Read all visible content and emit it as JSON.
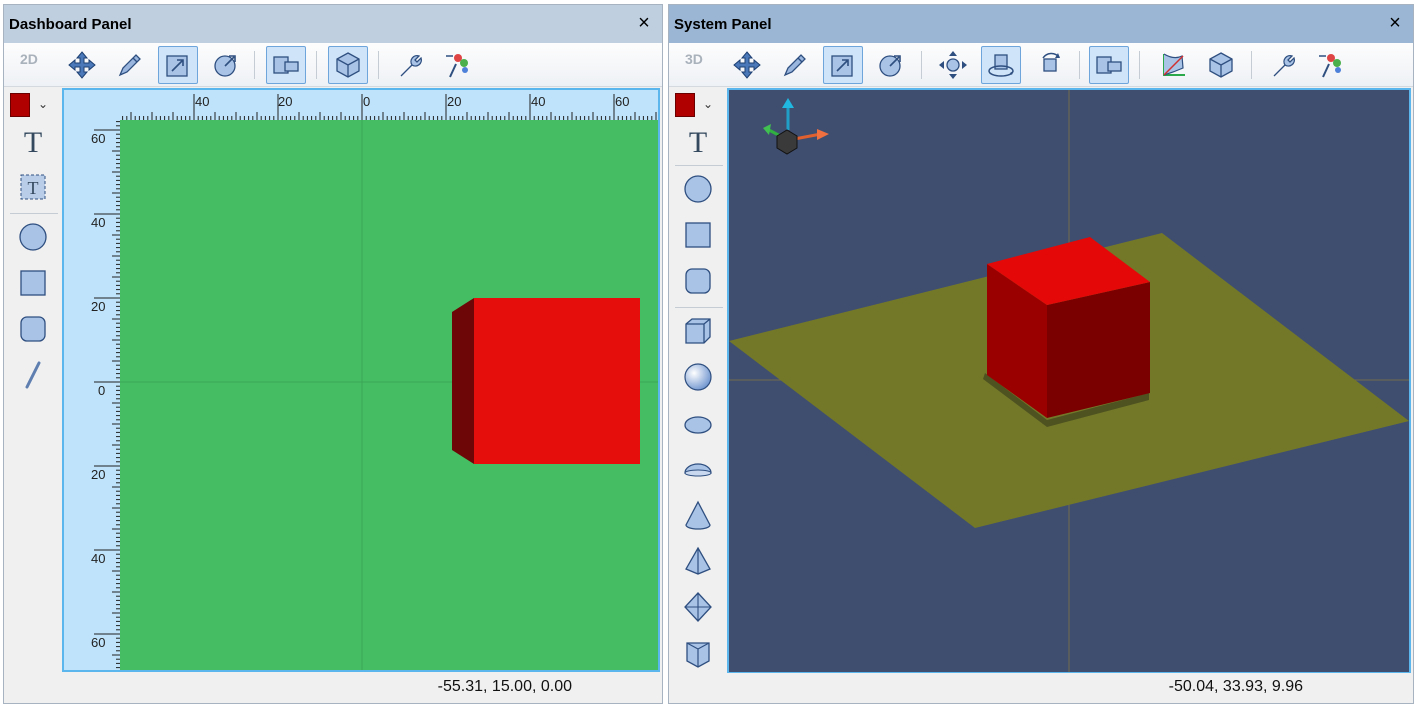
{
  "left_panel": {
    "title": "Dashboard Panel",
    "close_label": "×",
    "mode_label": "2D",
    "coordinates": "-55.31, 15.00, 0.00",
    "ruler_top_labels": [
      "40",
      "20",
      "0",
      "20",
      "40",
      "60"
    ],
    "ruler_left_labels": [
      "60",
      "40",
      "20",
      "0",
      "20",
      "40",
      "60"
    ],
    "colors": {
      "canvas": "#45bd63",
      "ruler": "#bfe3fa",
      "cube_face": "#e60d0d",
      "cube_side": "#6d0606",
      "selected_color": "#b00000"
    }
  },
  "right_panel": {
    "title": "System Panel",
    "close_label": "×",
    "mode_label": "3D",
    "coordinates": "-50.04, 33.93, 9.96",
    "colors": {
      "background": "#3f4e6f",
      "plane": "#737829",
      "cube_top": "#e40808",
      "cube_front": "#7a0000",
      "cube_left": "#9b0000",
      "selected_color": "#b00000"
    }
  },
  "toolbar_icons_2d": [
    "move-icon",
    "pen-icon",
    "scale-icon",
    "rotate-icon",
    "align-icon",
    "box-3d-icon",
    "wrench-icon",
    "paint-icon"
  ],
  "toolbar_icons_3d": [
    "move-icon",
    "pen-icon",
    "scale-icon",
    "rotate-icon",
    "pan-icon",
    "orbit-icon",
    "rotate-view-icon",
    "align-icon",
    "bounding-box-icon",
    "box-3d-icon",
    "wrench-icon",
    "paint-icon"
  ],
  "side_tools_2d": [
    "text-icon",
    "text-box-icon",
    "circle-icon",
    "rectangle-icon",
    "rounded-rectangle-icon",
    "line-icon"
  ],
  "side_tools_3d": [
    "text-icon",
    "circle-icon",
    "rectangle-icon",
    "rounded-rectangle-icon",
    "cube-icon",
    "sphere-icon",
    "ellipsoid-icon",
    "half-ellipsoid-icon",
    "cone-icon",
    "pyramid-icon",
    "octahedron-icon",
    "prism-icon"
  ]
}
